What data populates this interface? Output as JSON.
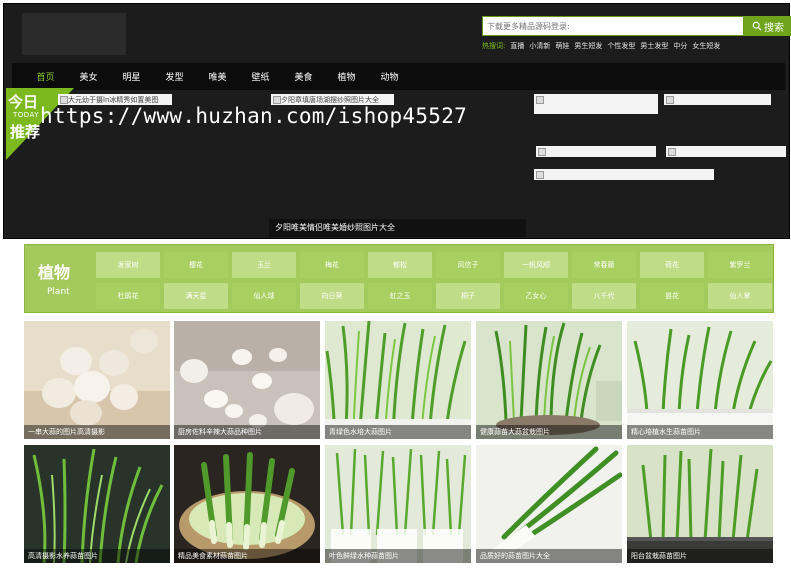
{
  "search": {
    "placeholder": "下载更多精品源码登录:",
    "button": "搜索",
    "hot_label": "热搜词:",
    "hot_links": [
      "直播",
      "小清新",
      "萌娃",
      "男生短发",
      "个性发型",
      "男士发型",
      "中分",
      "女生短发"
    ]
  },
  "nav": {
    "items": [
      "首页",
      "美女",
      "明星",
      "发型",
      "唯美",
      "壁纸",
      "美食",
      "植物",
      "动物"
    ]
  },
  "today": {
    "line1": "今日",
    "line2": "TODAY",
    "line3": "推荐"
  },
  "banner": {
    "link1": "大元幼于摄ln冰精秀如置美图",
    "link2": "夕阳章填唐场湖摆纱照图片大全",
    "link3": "",
    "link4": "",
    "link5": "",
    "link6": "",
    "link7": "",
    "caption": "夕阳唯美情侣唯美婚纱照图片大全"
  },
  "watermark": "https://www.huzhan.com/ishop45527",
  "category": {
    "title": "植物",
    "subtitle": "Plant",
    "items": [
      "发家树",
      "樱花",
      "玉兰",
      "梅花",
      "郁松",
      "风信子",
      "一帆风顺",
      "常春藤",
      "荷花",
      "紫罗兰",
      "杜鹃花",
      "满天星",
      "仙人球",
      "向日葵",
      "虹之玉",
      "桐子",
      "乙女心",
      "八千代",
      "昙花",
      "仙人掌"
    ]
  },
  "photos": [
    {
      "caption": "一串大蒜的图片高清摄影",
      "icon": "garlic-bulb-photo"
    },
    {
      "caption": "厨房佐料辛辣大蒜品种图片",
      "icon": "garlic-cloves-photo"
    },
    {
      "caption": "青绿色水培大蒜图片",
      "icon": "green-sprouts-photo"
    },
    {
      "caption": "健康蒜苗大蒜盆栽图片",
      "icon": "potted-sprouts-photo"
    },
    {
      "caption": "精心培植水生蒜苗图片",
      "icon": "white-pot-sprouts-photo"
    },
    {
      "caption": "高清摄影水养蒜苗图片",
      "icon": "dark-sprouts-photo"
    },
    {
      "caption": "精品美食素材蒜苗图片",
      "icon": "scallion-basket-photo"
    },
    {
      "caption": "叶色鲜绿水种蒜苗图片",
      "icon": "water-glass-sprouts-photo"
    },
    {
      "caption": "品质好的蒜苗图片大全",
      "icon": "leek-bundle-photo"
    },
    {
      "caption": "阳台盆栽蒜苗图片",
      "icon": "balcony-sprouts-photo"
    }
  ],
  "colors": {
    "accent": "#6ea31b",
    "nav_active": "#8bc82a",
    "panel": "#a4c95c",
    "header_bg": "#1c1c1c"
  }
}
